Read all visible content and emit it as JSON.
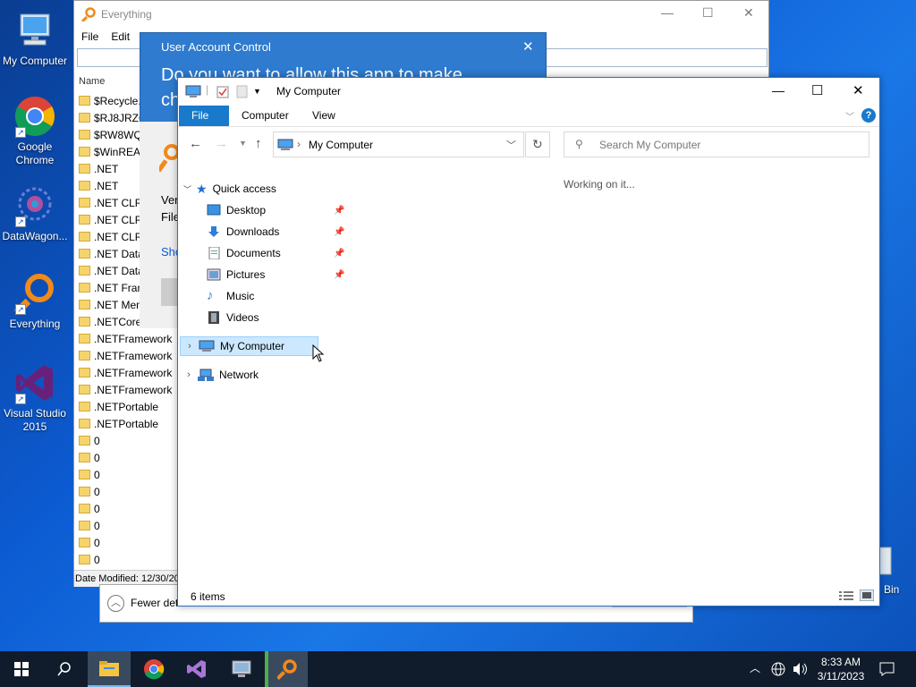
{
  "desktop": {
    "icons": [
      {
        "label": "My Computer",
        "icon": "monitor-icon"
      },
      {
        "label": "Google Chrome",
        "icon": "chrome-icon"
      },
      {
        "label": "DataWagon...",
        "icon": "datawagon-icon"
      },
      {
        "label": "Everything",
        "icon": "everything-icon"
      },
      {
        "label": "Visual Studio 2015",
        "icon": "visual-studio-icon"
      }
    ],
    "recycle_bin_partial": "Bin"
  },
  "everything": {
    "title": "Everything",
    "menu": [
      "File",
      "Edit"
    ],
    "column_name": "Name",
    "rows": [
      "$Recycle.B",
      "$RJ8JRZC",
      "$RW8WQ",
      "$WinREAg",
      ".NET",
      ".NET",
      ".NET CLR",
      ".NET CLR",
      ".NET CLR",
      ".NET Data",
      ".NET Data",
      ".NET Fram",
      ".NET Mem",
      ".NETCore",
      ".NETFramework",
      ".NETFramework",
      ".NETFramework",
      ".NETFramework",
      ".NETPortable",
      ".NETPortable",
      "0",
      "0",
      "0",
      "0",
      "0",
      "0",
      "0",
      "0"
    ],
    "status": "Date Modified: 12/30/20"
  },
  "uac": {
    "title": "User Account Control",
    "question_line1": "Do you want to allow this app to make",
    "question_line2": "ch",
    "verified_partial": "Ver",
    "file_partial": "File",
    "show_partial": "Sho",
    "fewer_details": "Fewer det"
  },
  "explorer": {
    "title": "My Computer",
    "ribbon_tabs": [
      "File",
      "Computer",
      "View"
    ],
    "address": "My Computer",
    "search_placeholder": "Search My Computer",
    "working": "Working on it...",
    "nav": {
      "quick_access": "Quick access",
      "items": [
        {
          "label": "Desktop",
          "pinned": true
        },
        {
          "label": "Downloads",
          "pinned": true
        },
        {
          "label": "Documents",
          "pinned": true
        },
        {
          "label": "Pictures",
          "pinned": true
        },
        {
          "label": "Music",
          "pinned": false
        },
        {
          "label": "Videos",
          "pinned": false
        }
      ],
      "my_computer": "My Computer",
      "network": "Network"
    },
    "status_items": "6 items"
  },
  "taskbar": {
    "time": "8:33 AM",
    "date": "3/11/2023"
  },
  "colors": {
    "accent": "#0b5bd3",
    "selected": "#cce8ff",
    "uac_blue": "#2e7bcf"
  }
}
